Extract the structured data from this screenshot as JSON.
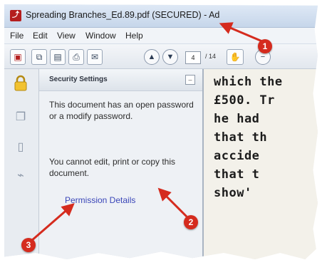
{
  "window": {
    "title": "Spreading Branches_Ed.89.pdf (SECURED) - Ad",
    "icon": "acrobat-icon"
  },
  "menu": [
    "File",
    "Edit",
    "View",
    "Window",
    "Help"
  ],
  "toolbar": {
    "page_current": "4",
    "page_total": "/ 14"
  },
  "panel": {
    "title": "Security Settings",
    "message1": "This document has an open password or a modify password.",
    "message2": "You cannot edit, print or copy this document.",
    "link": "Permission Details"
  },
  "document": {
    "lines": [
      "which the",
      "£500.  Tr",
      "he had",
      "that th",
      "accide",
      "that t",
      "show'"
    ]
  },
  "callouts": {
    "one": "1",
    "two": "2",
    "three": "3"
  },
  "colors": {
    "callout": "#d52b1e",
    "link": "#3a46b8"
  }
}
